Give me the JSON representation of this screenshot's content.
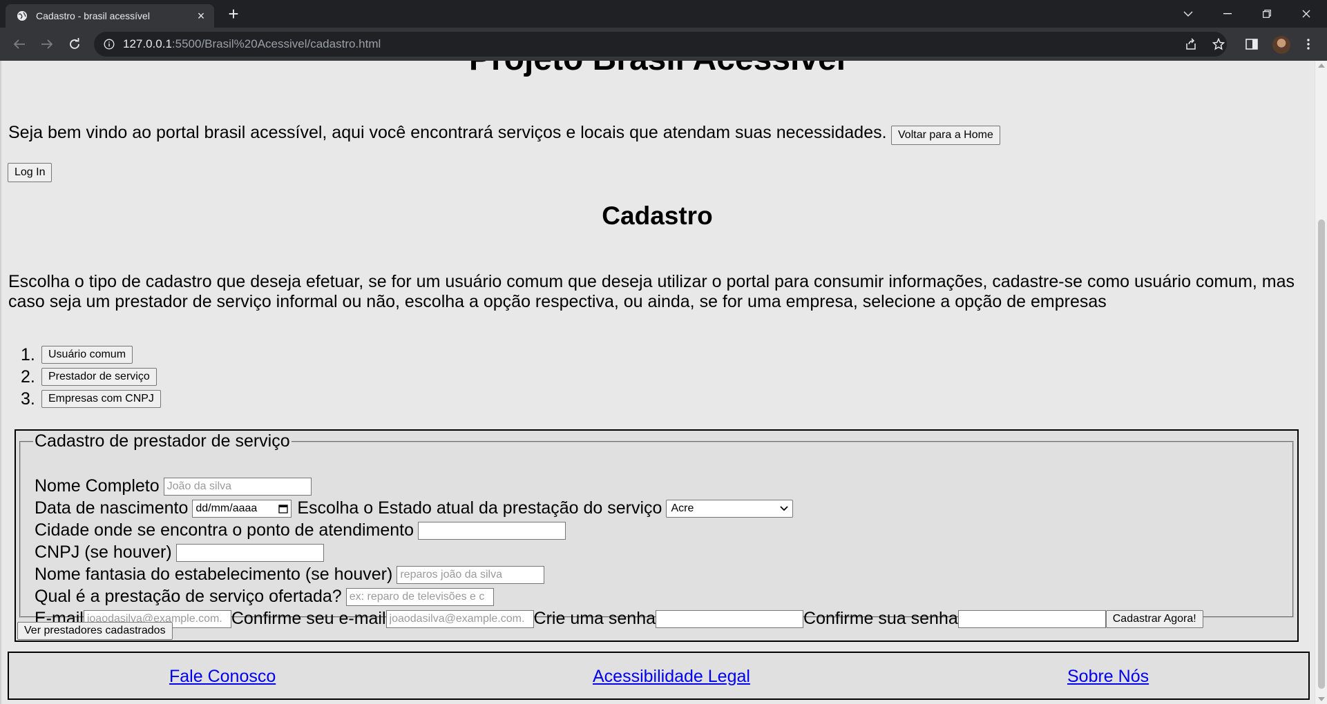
{
  "browser": {
    "tab_title": "Cadastro - brasil acessível",
    "url_host": "127.0.0.1",
    "url_path": ":5500/Brasil%20Acessivel/cadastro.html"
  },
  "page": {
    "project_title": "Projeto Brasil Acessível",
    "welcome_text": "Seja bem vindo ao portal brasil acessível, aqui você encontrará serviços e locais que atendam suas necessidades.",
    "home_button": "Voltar para a Home",
    "login_button": "Log In",
    "section_title": "Cadastro",
    "intro_text": "Escolha o tipo de cadastro que deseja efetuar, se for um usuário comum que deseja utilizar o portal para consumir informações, cadastre-se como usuário comum, mas caso seja um prestador de serviço informal ou não, escolha a opção respectiva, ou ainda, se for uma empresa, selecione a opção de empresas",
    "types": [
      {
        "num": "1.",
        "label": "Usuário comum"
      },
      {
        "num": "2.",
        "label": "Prestador de serviço"
      },
      {
        "num": "3.",
        "label": "Empresas com CNPJ"
      }
    ]
  },
  "form": {
    "legend": "Cadastro de prestador de serviço",
    "name_label": "Nome Completo",
    "name_placeholder": "João da silva",
    "birth_label": "Data de nascimento",
    "birth_value": "dd/mm/aaaa",
    "state_label": "Escolha o Estado atual da prestação do serviço",
    "state_selected": "Acre",
    "city_label": "Cidade onde se encontra o ponto de atendimento",
    "cnpj_label": "CNPJ (se houver)",
    "fantasy_label": "Nome fantasia do estabelecimento (se houver)",
    "fantasy_placeholder": "reparos joão da silva",
    "service_label": "Qual é a prestação de serviço ofertada?",
    "service_placeholder": "ex: reparo de televisões e c",
    "email_label": "E-mail",
    "email_placeholder": "joaodasilva@example.com.",
    "confirm_email_label": "Confirme seu e-mail",
    "confirm_email_placeholder": "joaodasilva@example.com.",
    "password_label": "Crie uma senha",
    "confirm_password_label": "Confirme sua senha",
    "submit_button": "Cadastrar Agora!",
    "list_button": "Ver prestadores cadastrados"
  },
  "footer": {
    "links": [
      "Fale Conosco",
      "Acessibilidade Legal",
      "Sobre Nós"
    ]
  }
}
